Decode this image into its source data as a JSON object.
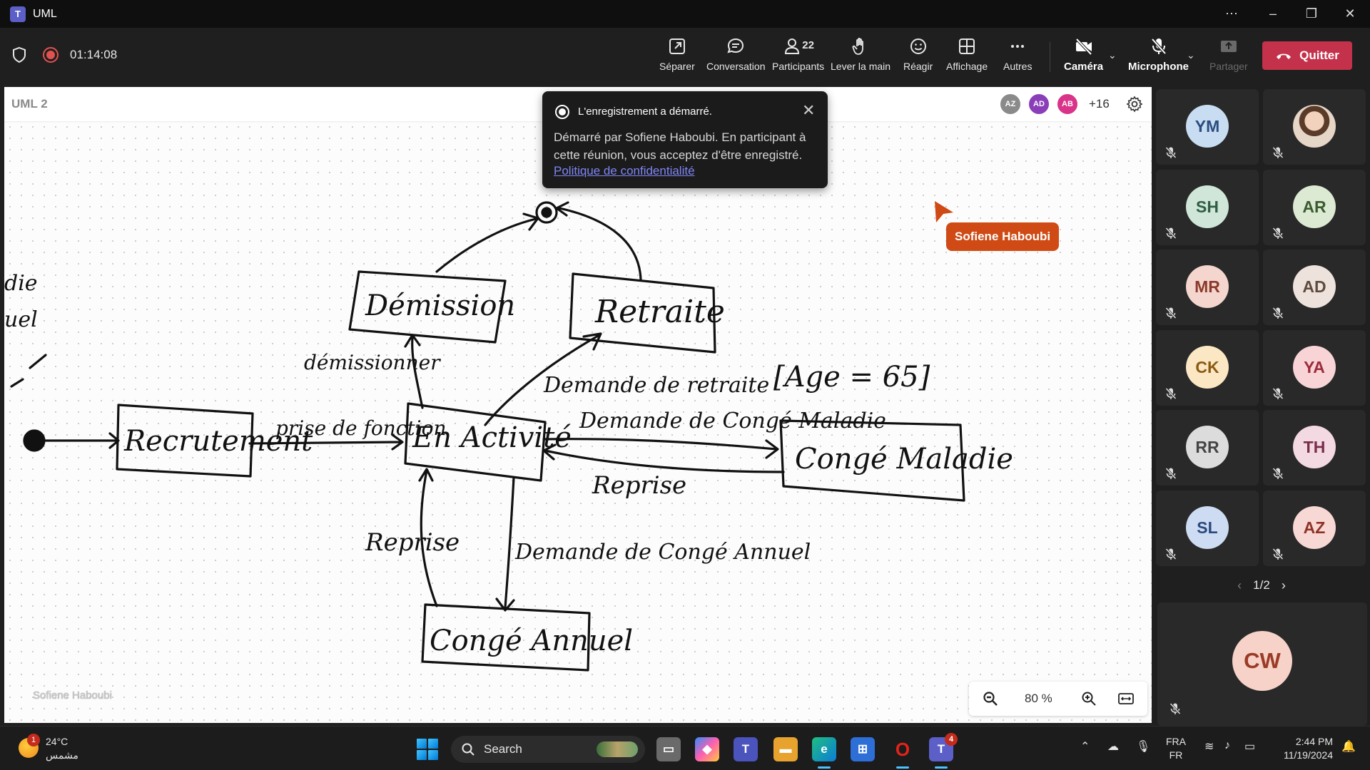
{
  "window": {
    "title": "UML"
  },
  "meeting": {
    "timer": "01:14:08"
  },
  "toolbar": {
    "separate": "Séparer",
    "chat": "Conversation",
    "participants": "Participants",
    "participants_count": "22",
    "raise_hand": "Lever la main",
    "react": "Réagir",
    "view": "Affichage",
    "more": "Autres",
    "camera": "Caméra",
    "microphone": "Microphone",
    "share": "Partager",
    "quit": "Quitter"
  },
  "whiteboard": {
    "title": "UML 2",
    "presence": [
      {
        "initials": "AZ",
        "color": "#8a8a8a"
      },
      {
        "initials": "AD",
        "color": "#8a3fb8"
      },
      {
        "initials": "AB",
        "color": "#d9338a"
      }
    ],
    "presence_more": "+16",
    "cursor_user": "Sofiene Haboubi",
    "watermark": "Sofiene Haboubi",
    "zoom": "80 %",
    "sketch": {
      "left_fragments": [
        "die",
        "uel"
      ],
      "states": [
        "Recrutement",
        "En Activité",
        "Démission",
        "Retraite",
        "Congé Maladie",
        "Congé Annuel"
      ],
      "transitions": [
        "prise de fonction",
        "démissionner",
        "Demande de retraite",
        "[Age = 65]",
        "Demande de Congé Maladie",
        "Reprise",
        "Reprise",
        "Demande de Congé Annuel"
      ]
    }
  },
  "toast": {
    "title": "L'enregistrement a démarré.",
    "body": "Démarré par Sofiene Haboubi. En participant à cette réunion, vous acceptez d'être enregistré.",
    "link": "Politique de confidentialité"
  },
  "gallery": {
    "tiles": [
      {
        "initials": "YM",
        "bg": "#c9ddf2",
        "fg": "#2b4d7e"
      },
      {
        "initials": "",
        "bg": "#d9b59b",
        "fg": "#fff",
        "photo": true
      },
      {
        "initials": "SH",
        "bg": "#cfe6d8",
        "fg": "#2e5e43"
      },
      {
        "initials": "AR",
        "bg": "#dcead3",
        "fg": "#3b5b2d"
      },
      {
        "initials": "MR",
        "bg": "#f4d6cf",
        "fg": "#8a3a2a"
      },
      {
        "initials": "AD",
        "bg": "#eee3dc",
        "fg": "#5e4b3e"
      },
      {
        "initials": "CK",
        "bg": "#fbe7c4",
        "fg": "#8a5a12"
      },
      {
        "initials": "YA",
        "bg": "#f8d4d6",
        "fg": "#9b2c3a"
      },
      {
        "initials": "RR",
        "bg": "#dcdcdc",
        "fg": "#444"
      },
      {
        "initials": "TH",
        "bg": "#f3d9e2",
        "fg": "#7a2d4a"
      },
      {
        "initials": "SL",
        "bg": "#cddcf2",
        "fg": "#2a4a7d"
      },
      {
        "initials": "AZ",
        "bg": "#f8d8d4",
        "fg": "#8e3228"
      }
    ],
    "page": "1/2",
    "self": {
      "initials": "CW",
      "bg": "#f6d2c8",
      "fg": "#9a3b26"
    }
  },
  "taskbar": {
    "weather_badge": "1",
    "temperature": "24°C",
    "weather_desc": "مشمس",
    "search": "Search",
    "teams_badge": "4",
    "lang_top": "FRA",
    "lang_bottom": "FR",
    "time": "2:44 PM",
    "date": "11/19/2024"
  },
  "colors": {
    "accent": "#5b5fc7",
    "danger": "#c4314b",
    "cursor": "#cf4a14",
    "link": "#7f85f5"
  }
}
